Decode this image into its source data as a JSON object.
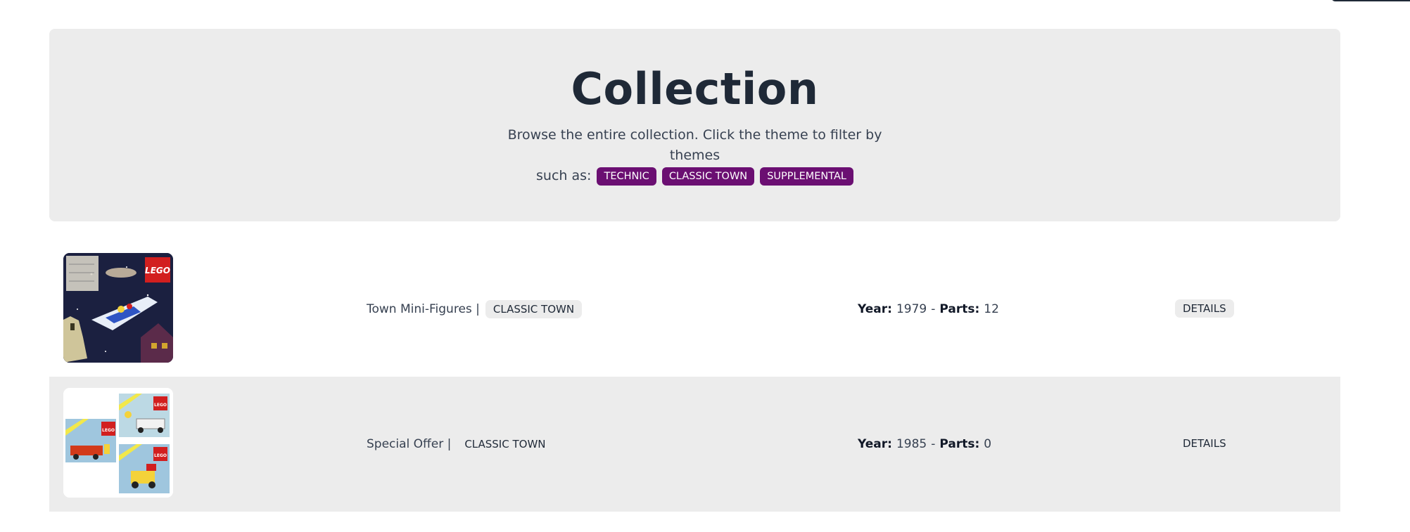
{
  "hero": {
    "title": "Collection",
    "description_line1": "Browse the entire collection. Click the theme to filter by themes",
    "description_line2": "such as:",
    "themes": [
      "TECHNIC",
      "CLASSIC TOWN",
      "SUPPLEMENTAL"
    ]
  },
  "sets": [
    {
      "name": "Town Mini-Figures |",
      "theme": "CLASSIC TOWN",
      "year_label": "Year:",
      "year": "1979",
      "separator": "-",
      "parts_label": "Parts:",
      "parts": "12",
      "details_label": "DETAILS",
      "image": "space-shuttle-box-photo"
    },
    {
      "name": "Special Offer |",
      "theme": "CLASSIC TOWN",
      "year_label": "Year:",
      "year": "1985",
      "separator": "-",
      "parts_label": "Parts:",
      "parts": "0",
      "details_label": "DETAILS",
      "image": "town-sets-combo-photo"
    }
  ],
  "colors": {
    "accent_purple": "#6b0f72",
    "panel_gray": "#ececec",
    "text_dark": "#1f2937"
  }
}
